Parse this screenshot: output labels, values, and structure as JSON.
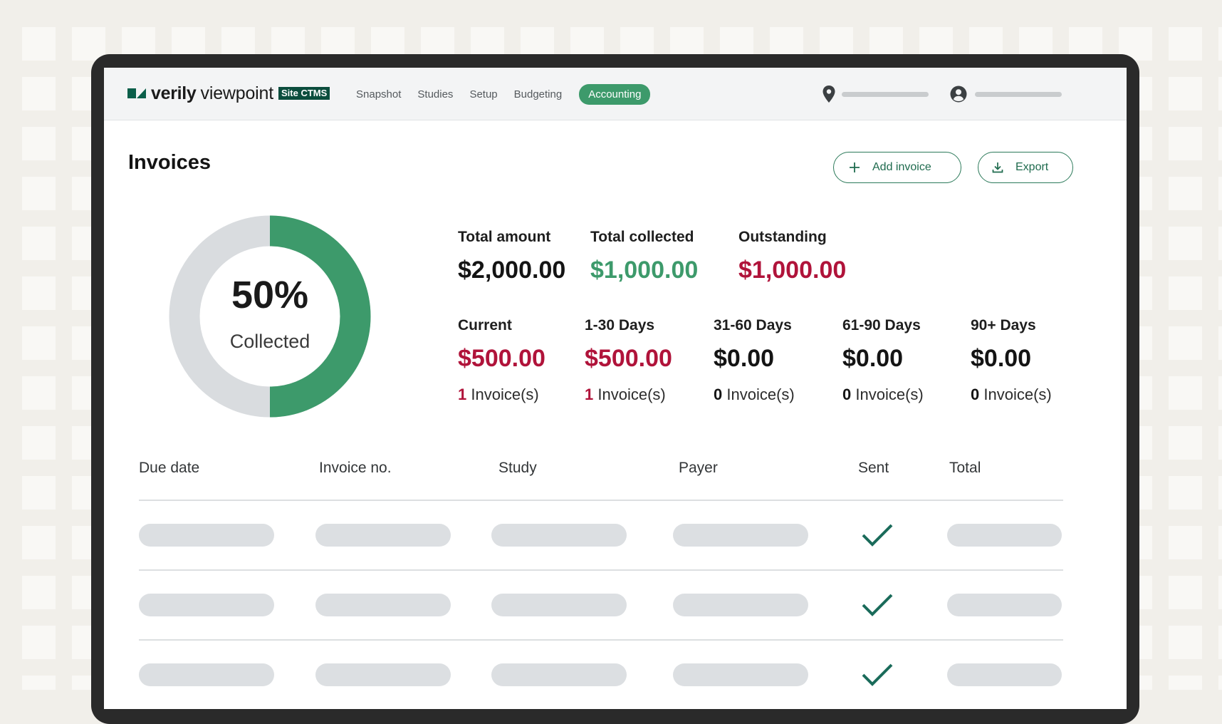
{
  "app": {
    "brand_bold": "verily",
    "brand_regular": "viewpoint",
    "brand_badge": "Site CTMS"
  },
  "nav": {
    "items": [
      "Snapshot",
      "Studies",
      "Setup",
      "Budgeting"
    ],
    "active": "Accounting"
  },
  "page": {
    "title": "Invoices",
    "add_invoice_label": "Add invoice",
    "export_label": "Export"
  },
  "donut": {
    "percent_label": "50%",
    "caption": "Collected",
    "collected_fraction": 0.5,
    "colors": {
      "collected": "#3d9a6b",
      "remaining": "#d9dcdf"
    }
  },
  "totals": [
    {
      "label": "Total amount",
      "value": "$2,000.00",
      "tone": "dark"
    },
    {
      "label": "Total collected",
      "value": "$1,000.00",
      "tone": "green"
    },
    {
      "label": "Outstanding",
      "value": "$1,000.00",
      "tone": "red"
    }
  ],
  "aging": [
    {
      "label": "Current",
      "value": "$500.00",
      "count": "1",
      "count_suffix": " Invoice(s)",
      "tone": "red"
    },
    {
      "label": "1-30 Days",
      "value": "$500.00",
      "count": "1",
      "count_suffix": " Invoice(s)",
      "tone": "red"
    },
    {
      "label": "31-60 Days",
      "value": "$0.00",
      "count": "0",
      "count_suffix": " Invoice(s)",
      "tone": "dark"
    },
    {
      "label": "61-90 Days",
      "value": "$0.00",
      "count": "0",
      "count_suffix": " Invoice(s)",
      "tone": "dark"
    },
    {
      "label": "90+ Days",
      "value": "$0.00",
      "count": "0",
      "count_suffix": " Invoice(s)",
      "tone": "dark"
    }
  ],
  "table": {
    "columns": [
      "Due date",
      "Invoice no.",
      "Study",
      "Payer",
      "Sent",
      "Total"
    ],
    "rows": [
      {
        "sent": true
      },
      {
        "sent": true
      },
      {
        "sent": true
      }
    ]
  },
  "icons": {
    "location": "location-pin-icon",
    "user": "user-account-icon",
    "add": "plus-icon",
    "export": "download-icon",
    "sent": "checkmark-icon"
  },
  "colors": {
    "brand": "#0b5f4a",
    "accent": "#3d9a6b",
    "negative": "#b0133a"
  }
}
